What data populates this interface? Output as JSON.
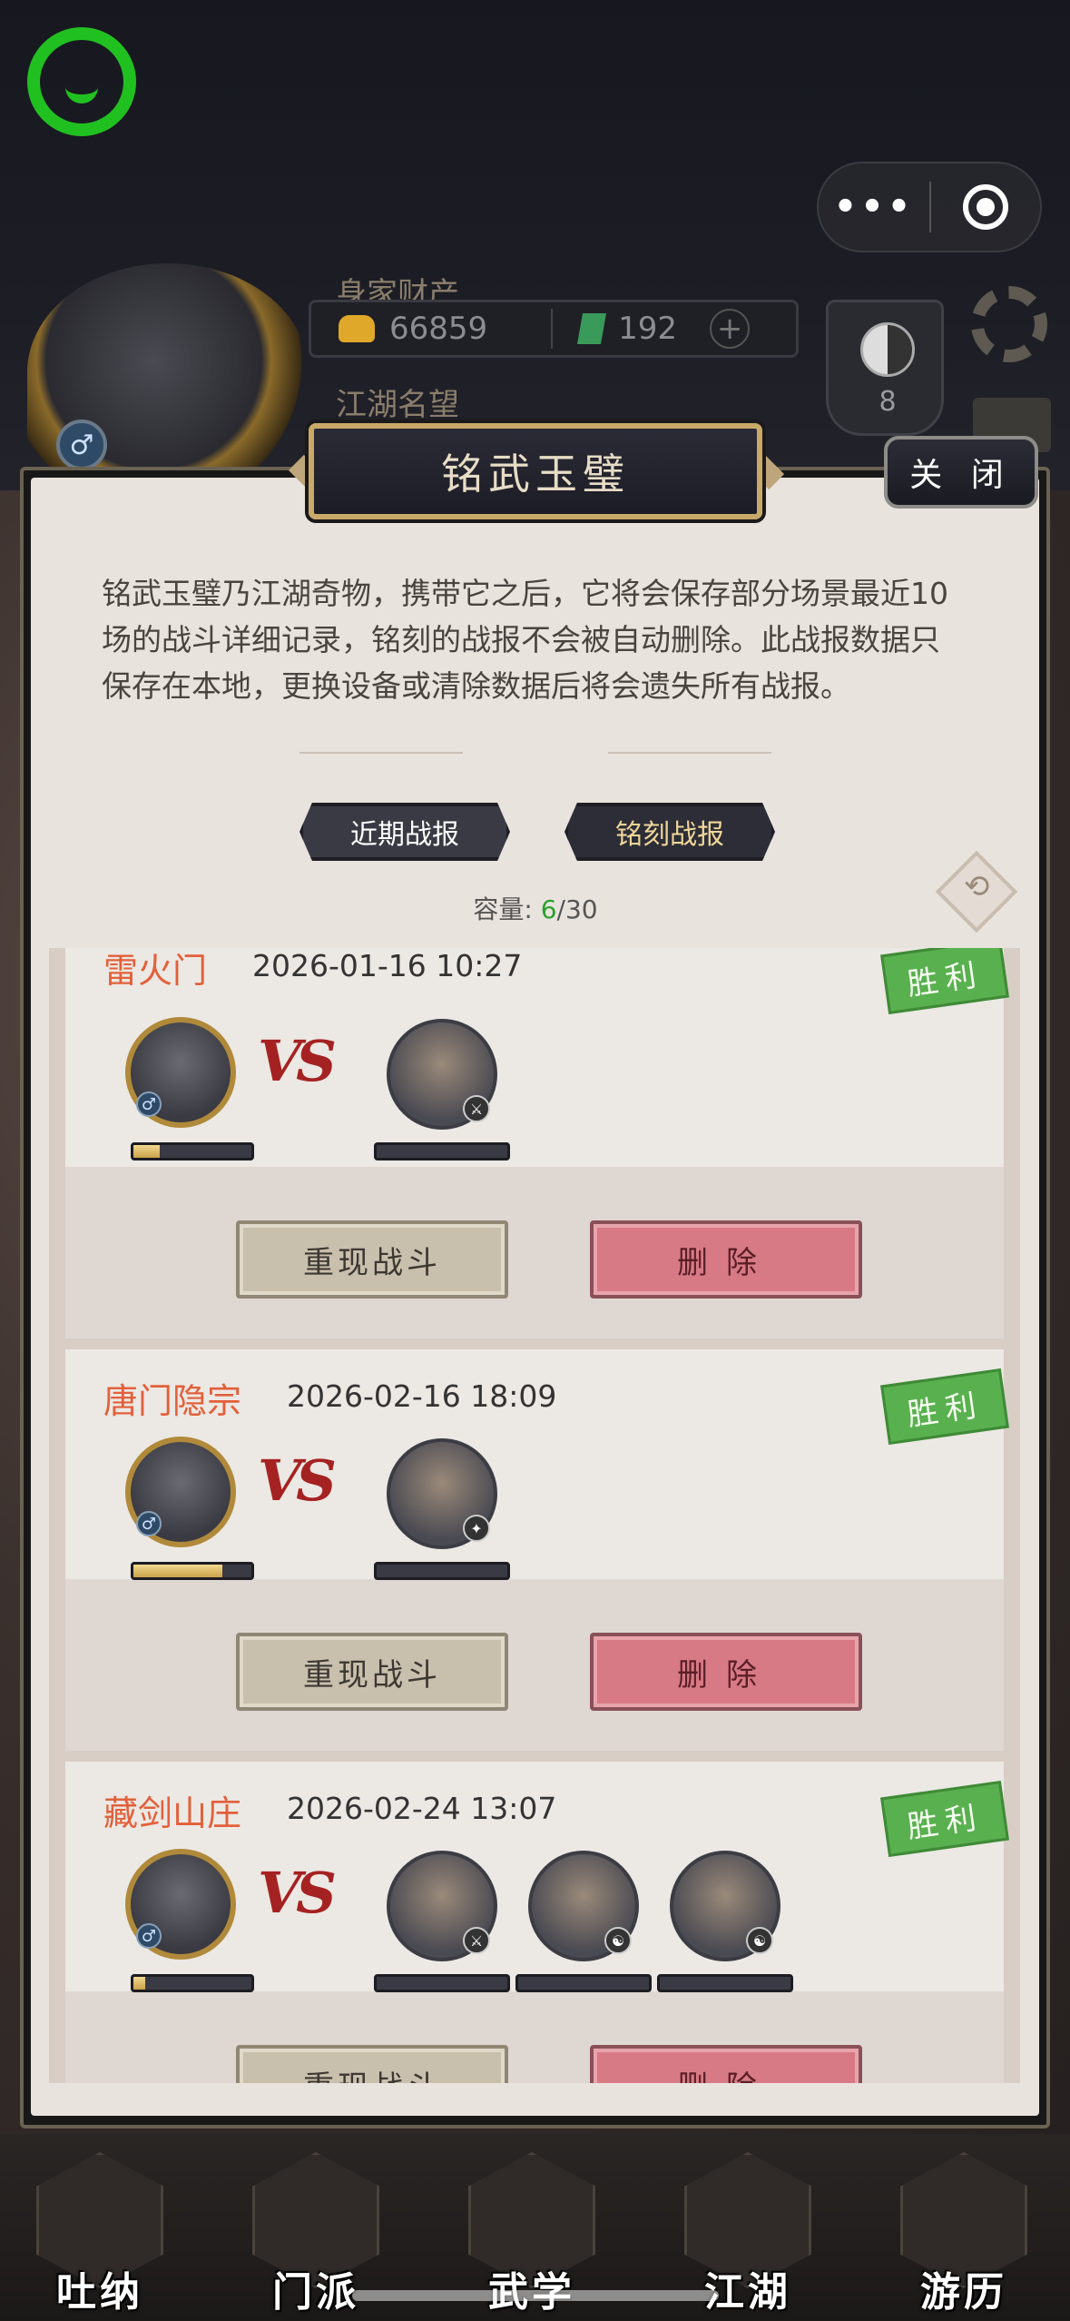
{
  "hud": {
    "wealth_label": "身家财产",
    "gold": "66859",
    "jade": "192",
    "fame_label": "江湖名望",
    "level": "8"
  },
  "modal": {
    "title": "铭武玉璧",
    "close_label": "关 闭",
    "description": "铭武玉璧乃江湖奇物，携带它之后，它将会保存部分场景最近10场的战斗详细记录，铭刻的战报不会被自动删除。此战报数据只保存在本地，更换设备或清除数据后将会遗失所有战报。",
    "tabs": [
      {
        "label": "近期战报",
        "active": false
      },
      {
        "label": "铭刻战报",
        "active": true
      }
    ],
    "capacity_label": "容量:",
    "capacity_used": "6",
    "capacity_total": "/30"
  },
  "records": [
    {
      "sect": "雷火门",
      "time": "2026-01-16 10:27",
      "result": "胜利",
      "player_progress": 0.22,
      "enemies": 1,
      "replay_label": "重现战斗",
      "delete_label": "删除"
    },
    {
      "sect": "唐门隐宗",
      "time": "2026-02-16 18:09",
      "result": "胜利",
      "player_progress": 0.75,
      "enemies": 1,
      "replay_label": "重现战斗",
      "delete_label": "删除"
    },
    {
      "sect": "藏剑山庄",
      "time": "2026-02-24 13:07",
      "result": "胜利",
      "player_progress": 0.1,
      "enemies": 3,
      "replay_label": "重现战斗",
      "delete_label": "删除"
    }
  ],
  "vs_label": "VS",
  "nav": [
    {
      "label": "吐纳"
    },
    {
      "label": "门派"
    },
    {
      "label": "武学"
    },
    {
      "label": "江湖"
    },
    {
      "label": "游历"
    }
  ],
  "colors": {
    "accent_orange": "#e2603a",
    "win_green": "#59b04f",
    "capacity_green": "#2aa12a"
  }
}
